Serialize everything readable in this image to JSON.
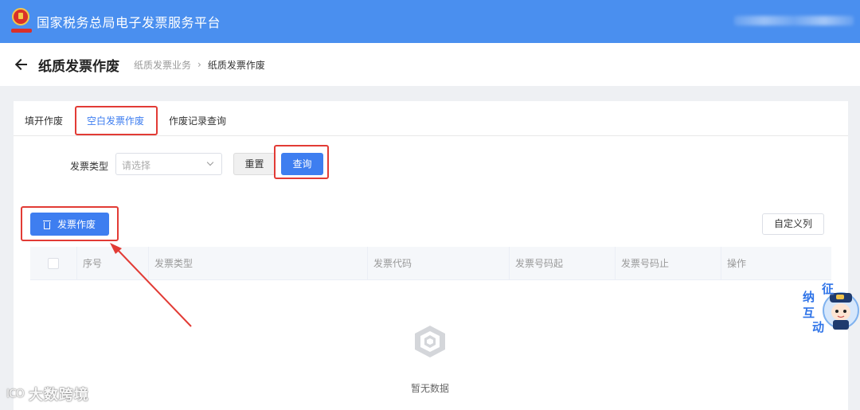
{
  "header": {
    "app_title": "国家税务总局电子发票服务平台",
    "logo_icon": "tax-emblem-icon"
  },
  "page": {
    "title": "纸质发票作废",
    "breadcrumb": [
      "纸质发票业务",
      "纸质发票作废"
    ],
    "breadcrumb_separator": "›"
  },
  "tabs": [
    {
      "label": "填开作废",
      "active": false
    },
    {
      "label": "空白发票作废",
      "active": true
    },
    {
      "label": "作废记录查询",
      "active": false
    }
  ],
  "filter": {
    "label": "发票类型",
    "placeholder": "请选择",
    "reset_label": "重置",
    "query_label": "查询"
  },
  "toolbar": {
    "void_label": "发票作废",
    "void_icon": "trash-icon",
    "columns_label": "自定义列"
  },
  "table": {
    "columns": [
      "序号",
      "发票类型",
      "发票代码",
      "发票号码起",
      "发票号码止",
      "操作"
    ],
    "rows": [],
    "empty_text": "暂无数据"
  },
  "mascot": {
    "text": [
      "征",
      "纳",
      "互",
      "动"
    ]
  },
  "watermark": {
    "logo": "ICO",
    "text": "大数跨境"
  },
  "colors": {
    "topbar": "#4a8fef",
    "primary": "#3e7ef0",
    "highlight": "#e23b35"
  }
}
